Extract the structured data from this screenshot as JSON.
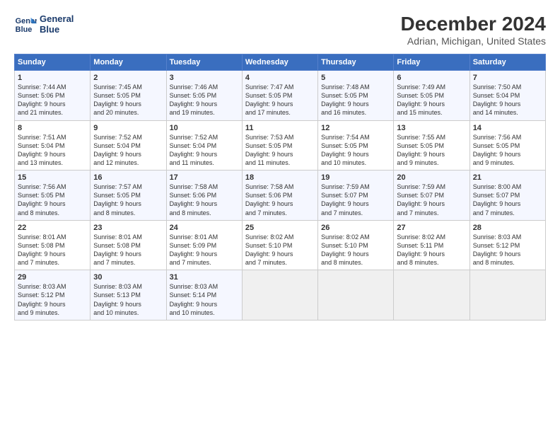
{
  "header": {
    "logo_line1": "General",
    "logo_line2": "Blue",
    "title": "December 2024",
    "subtitle": "Adrian, Michigan, United States"
  },
  "columns": [
    "Sunday",
    "Monday",
    "Tuesday",
    "Wednesday",
    "Thursday",
    "Friday",
    "Saturday"
  ],
  "weeks": [
    [
      {
        "day": "1",
        "info": "Sunrise: 7:44 AM\nSunset: 5:06 PM\nDaylight: 9 hours\nand 21 minutes."
      },
      {
        "day": "2",
        "info": "Sunrise: 7:45 AM\nSunset: 5:05 PM\nDaylight: 9 hours\nand 20 minutes."
      },
      {
        "day": "3",
        "info": "Sunrise: 7:46 AM\nSunset: 5:05 PM\nDaylight: 9 hours\nand 19 minutes."
      },
      {
        "day": "4",
        "info": "Sunrise: 7:47 AM\nSunset: 5:05 PM\nDaylight: 9 hours\nand 17 minutes."
      },
      {
        "day": "5",
        "info": "Sunrise: 7:48 AM\nSunset: 5:05 PM\nDaylight: 9 hours\nand 16 minutes."
      },
      {
        "day": "6",
        "info": "Sunrise: 7:49 AM\nSunset: 5:05 PM\nDaylight: 9 hours\nand 15 minutes."
      },
      {
        "day": "7",
        "info": "Sunrise: 7:50 AM\nSunset: 5:04 PM\nDaylight: 9 hours\nand 14 minutes."
      }
    ],
    [
      {
        "day": "8",
        "info": "Sunrise: 7:51 AM\nSunset: 5:04 PM\nDaylight: 9 hours\nand 13 minutes."
      },
      {
        "day": "9",
        "info": "Sunrise: 7:52 AM\nSunset: 5:04 PM\nDaylight: 9 hours\nand 12 minutes."
      },
      {
        "day": "10",
        "info": "Sunrise: 7:52 AM\nSunset: 5:04 PM\nDaylight: 9 hours\nand 11 minutes."
      },
      {
        "day": "11",
        "info": "Sunrise: 7:53 AM\nSunset: 5:05 PM\nDaylight: 9 hours\nand 11 minutes."
      },
      {
        "day": "12",
        "info": "Sunrise: 7:54 AM\nSunset: 5:05 PM\nDaylight: 9 hours\nand 10 minutes."
      },
      {
        "day": "13",
        "info": "Sunrise: 7:55 AM\nSunset: 5:05 PM\nDaylight: 9 hours\nand 9 minutes."
      },
      {
        "day": "14",
        "info": "Sunrise: 7:56 AM\nSunset: 5:05 PM\nDaylight: 9 hours\nand 9 minutes."
      }
    ],
    [
      {
        "day": "15",
        "info": "Sunrise: 7:56 AM\nSunset: 5:05 PM\nDaylight: 9 hours\nand 8 minutes."
      },
      {
        "day": "16",
        "info": "Sunrise: 7:57 AM\nSunset: 5:05 PM\nDaylight: 9 hours\nand 8 minutes."
      },
      {
        "day": "17",
        "info": "Sunrise: 7:58 AM\nSunset: 5:06 PM\nDaylight: 9 hours\nand 8 minutes."
      },
      {
        "day": "18",
        "info": "Sunrise: 7:58 AM\nSunset: 5:06 PM\nDaylight: 9 hours\nand 7 minutes."
      },
      {
        "day": "19",
        "info": "Sunrise: 7:59 AM\nSunset: 5:07 PM\nDaylight: 9 hours\nand 7 minutes."
      },
      {
        "day": "20",
        "info": "Sunrise: 7:59 AM\nSunset: 5:07 PM\nDaylight: 9 hours\nand 7 minutes."
      },
      {
        "day": "21",
        "info": "Sunrise: 8:00 AM\nSunset: 5:07 PM\nDaylight: 9 hours\nand 7 minutes."
      }
    ],
    [
      {
        "day": "22",
        "info": "Sunrise: 8:01 AM\nSunset: 5:08 PM\nDaylight: 9 hours\nand 7 minutes."
      },
      {
        "day": "23",
        "info": "Sunrise: 8:01 AM\nSunset: 5:08 PM\nDaylight: 9 hours\nand 7 minutes."
      },
      {
        "day": "24",
        "info": "Sunrise: 8:01 AM\nSunset: 5:09 PM\nDaylight: 9 hours\nand 7 minutes."
      },
      {
        "day": "25",
        "info": "Sunrise: 8:02 AM\nSunset: 5:10 PM\nDaylight: 9 hours\nand 7 minutes."
      },
      {
        "day": "26",
        "info": "Sunrise: 8:02 AM\nSunset: 5:10 PM\nDaylight: 9 hours\nand 8 minutes."
      },
      {
        "day": "27",
        "info": "Sunrise: 8:02 AM\nSunset: 5:11 PM\nDaylight: 9 hours\nand 8 minutes."
      },
      {
        "day": "28",
        "info": "Sunrise: 8:03 AM\nSunset: 5:12 PM\nDaylight: 9 hours\nand 8 minutes."
      }
    ],
    [
      {
        "day": "29",
        "info": "Sunrise: 8:03 AM\nSunset: 5:12 PM\nDaylight: 9 hours\nand 9 minutes."
      },
      {
        "day": "30",
        "info": "Sunrise: 8:03 AM\nSunset: 5:13 PM\nDaylight: 9 hours\nand 10 minutes."
      },
      {
        "day": "31",
        "info": "Sunrise: 8:03 AM\nSunset: 5:14 PM\nDaylight: 9 hours\nand 10 minutes."
      },
      {
        "day": "",
        "info": ""
      },
      {
        "day": "",
        "info": ""
      },
      {
        "day": "",
        "info": ""
      },
      {
        "day": "",
        "info": ""
      }
    ]
  ]
}
